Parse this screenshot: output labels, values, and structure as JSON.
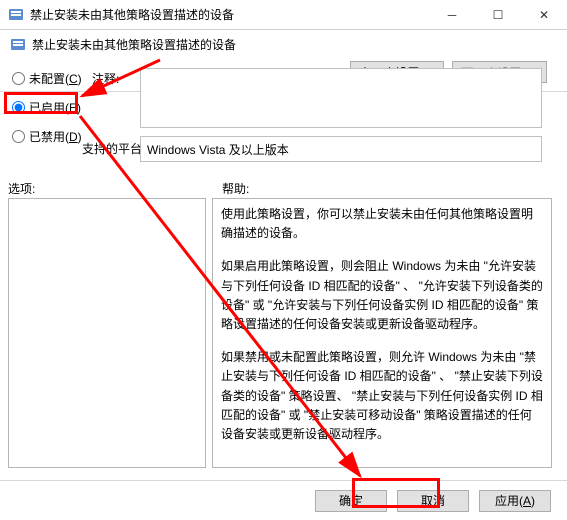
{
  "window": {
    "title": "禁止安装未由其他策略设置描述的设备"
  },
  "subheader": {
    "title": "禁止安装未由其他策略设置描述的设备"
  },
  "nav": {
    "prev_label": "上一个设置(P)",
    "next_label": "下一个设置(N)"
  },
  "radios": {
    "not_configured": "未配置(",
    "not_configured_key": "C",
    "not_configured_suffix": ")",
    "enabled": "已启用(",
    "enabled_key": "E",
    "enabled_suffix": ")",
    "disabled": "已禁用(",
    "disabled_key": "D",
    "disabled_suffix": ")"
  },
  "labels": {
    "comment": "注释:",
    "platform": "支持的平台:",
    "options": "选项:",
    "help": "帮助:"
  },
  "platform_value": "Windows Vista 及以上版本",
  "help": {
    "p1": "使用此策略设置，你可以禁止安装未由任何其他策略设置明确描述的设备。",
    "p2": "如果启用此策略设置，则会阻止 Windows 为未由 \"允许安装与下列任何设备 ID 相匹配的设备\" 、 \"允许安装下列设备类的设备\" 或 \"允许安装与下列任何设备实例 ID 相匹配的设备\" 策略设置描述的任何设备安装或更新设备驱动程序。",
    "p3": "如果禁用或未配置此策略设置，则允许 Windows 为未由 \"禁止安装与下列任何设备 ID 相匹配的设备\" 、 \"禁止安装下列设备类的设备\" 策略设置、 \"禁止安装与下列任何设备实例 ID 相匹配的设备\" 或 \"禁止安装可移动设备\" 策略设置描述的任何设备安装或更新设备驱动程序。"
  },
  "footer": {
    "ok": "确定",
    "cancel": "取消",
    "apply": "应用(",
    "apply_key": "A",
    "apply_suffix": ")"
  }
}
